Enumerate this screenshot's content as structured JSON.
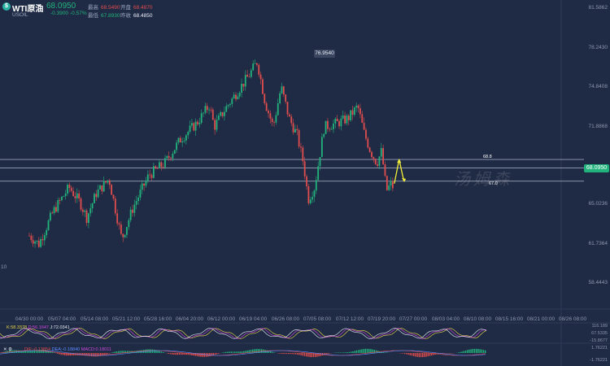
{
  "header": {
    "logo": "$",
    "symbol": "WTI原油",
    "subsymbol": "USOIL",
    "price": "68.0950",
    "change": "-0.3900",
    "change_pct": "-0.57%",
    "stats": [
      {
        "key": "最高",
        "value": "68.5490",
        "color": "#e04d4d"
      },
      {
        "key": "开盘",
        "value": "68.4870",
        "color": "#e04d4d"
      },
      {
        "key": "最低",
        "value": "67.8930",
        "color": "#22b37d"
      },
      {
        "key": "昨收",
        "value": "68.4850",
        "color": "#e6ebf5"
      }
    ]
  },
  "y_labels": [
    "81.5862",
    "78.2430",
    "74.8408",
    "71.8868",
    "68.0950",
    "65.0236",
    "61.7364",
    "58.4443"
  ],
  "current_price_label": "68.0950",
  "peak_label": "76.9540",
  "left_label": "10",
  "watermark": "汤姆森",
  "annotations": {
    "up": "68.8",
    "down": "67.0"
  },
  "x_labels": [
    "04/30 00:00",
    "05/07 04:00",
    "05/14 08:00",
    "05/21 12:00",
    "05/28 16:00",
    "06/04 20:00",
    "06/12 00:00",
    "06/19 04:00",
    "06/26 08:00",
    "07/05 08:00",
    "07/12 12:00",
    "07/19 20:00",
    "07/27 00:00",
    "08/03 04:00",
    "08/10 08:00",
    "08/15 16:00",
    "08/21 00:00",
    "08/26 08:00"
  ],
  "indicators": {
    "kdj": {
      "k": "K:58.3378",
      "d": "D:56.1647",
      "j": "J:72.0341"
    },
    "kdj_axis": [
      "116.189",
      "67.5335",
      "-15.8677"
    ],
    "macd": {
      "dif": "DIF:-0.13854",
      "dea": "DEA:-0.18840",
      "macd": "MACD:0.18011"
    },
    "macd_axis": [
      "1.76221",
      "-1.76221"
    ]
  },
  "colors": {
    "up": "#22b37d",
    "down": "#e04d4d",
    "bg": "#1f2a44",
    "line": "#d6dbe6"
  },
  "chart_data": {
    "type": "candlestick",
    "title": "WTI原油",
    "x_ticks": [
      "04/30 00:00",
      "05/07 04:00",
      "05/14 08:00",
      "05/21 12:00",
      "05/28 16:00",
      "06/04 20:00",
      "06/12 00:00",
      "06/19 04:00",
      "06/26 08:00",
      "07/05 08:00",
      "07/12 12:00",
      "07/19 20:00",
      "07/27 00:00",
      "08/03 04:00",
      "08/10 08:00",
      "08/15 16:00",
      "08/21 00:00",
      "08/26 08:00"
    ],
    "ylim": [
      58.0,
      81.8
    ],
    "y_ticks": [
      81.5862,
      78.243,
      74.8408,
      71.8868,
      68.095,
      65.0236,
      61.7364,
      58.4443
    ],
    "close_path": [
      {
        "x": 0.0,
        "y": 62.5
      },
      {
        "x": 0.6,
        "y": 61.8
      },
      {
        "x": 1.5,
        "y": 64.5
      },
      {
        "x": 2.5,
        "y": 66.5
      },
      {
        "x": 3.2,
        "y": 65.2
      },
      {
        "x": 3.6,
        "y": 64.0
      },
      {
        "x": 4.2,
        "y": 66.0
      },
      {
        "x": 5.0,
        "y": 67.2
      },
      {
        "x": 5.8,
        "y": 62.2
      },
      {
        "x": 6.5,
        "y": 64.8
      },
      {
        "x": 7.5,
        "y": 67.5
      },
      {
        "x": 8.5,
        "y": 68.5
      },
      {
        "x": 9.5,
        "y": 70.5
      },
      {
        "x": 10.5,
        "y": 71.8
      },
      {
        "x": 11.3,
        "y": 73.3
      },
      {
        "x": 11.6,
        "y": 71.5
      },
      {
        "x": 12.3,
        "y": 73.0
      },
      {
        "x": 13.1,
        "y": 74.5
      },
      {
        "x": 13.8,
        "y": 75.8
      },
      {
        "x": 14.3,
        "y": 76.9
      },
      {
        "x": 14.8,
        "y": 73.5
      },
      {
        "x": 15.3,
        "y": 71.5
      },
      {
        "x": 15.8,
        "y": 74.8
      },
      {
        "x": 16.3,
        "y": 72.2
      },
      {
        "x": 16.8,
        "y": 70.8
      },
      {
        "x": 17.2,
        "y": 68.5
      },
      {
        "x": 17.5,
        "y": 65.5
      },
      {
        "x": 17.9,
        "y": 66.5
      },
      {
        "x": 18.5,
        "y": 71.5
      },
      {
        "x": 19.3,
        "y": 71.8
      },
      {
        "x": 20.0,
        "y": 72.2
      },
      {
        "x": 20.6,
        "y": 73.2
      },
      {
        "x": 21.0,
        "y": 71.0
      },
      {
        "x": 21.4,
        "y": 69.5
      },
      {
        "x": 21.8,
        "y": 68.5
      },
      {
        "x": 22.1,
        "y": 69.5
      },
      {
        "x": 22.4,
        "y": 66.2
      },
      {
        "x": 22.7,
        "y": 66.8
      },
      {
        "x": 22.9,
        "y": 66.3
      }
    ],
    "h_levels": [
      68.8,
      68.095,
      67.0
    ],
    "peak": 76.954,
    "projection": [
      {
        "x": 22.9,
        "y": 66.8
      },
      {
        "x": 23.2,
        "y": 68.8
      },
      {
        "x": 23.5,
        "y": 67.0
      }
    ]
  }
}
